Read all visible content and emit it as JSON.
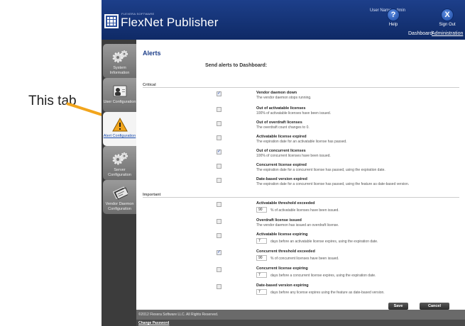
{
  "annotation": {
    "label": "This tab"
  },
  "header": {
    "vendor": "FLEXERA SOFTWARE",
    "product": "FlexNet Publisher",
    "user_name": "User Name: admin",
    "help_label": "Help",
    "help_glyph": "?",
    "signout_label": "Sign Out",
    "signout_glyph": "X",
    "links": {
      "dashboard": "Dashboard",
      "administration": "Administration"
    }
  },
  "sidebar": {
    "items": [
      {
        "label": "System Information",
        "icon": "gears-icon"
      },
      {
        "label": "User Configuration",
        "icon": "user-id-icon"
      },
      {
        "label": "Alert Configuration",
        "icon": "warning-icon",
        "active": true
      },
      {
        "label": "Server Configuration",
        "icon": "gears-icon"
      },
      {
        "label": "Vendor Daemon Configuration",
        "icon": "license-cards-icon"
      }
    ]
  },
  "main": {
    "title": "Alerts",
    "send_title": "Send alerts to Dashboard:",
    "critical_title": "Critical",
    "important_title": "Important",
    "critical": [
      {
        "title": "Vendor daemon down",
        "desc": "The vendor daemon stops running.",
        "checked": true
      },
      {
        "title": "Out of activatable licenses",
        "desc": "100% of activatable licenses have been issued.",
        "checked": false
      },
      {
        "title": "Out of overdraft licenses",
        "desc": "The overdraft count changes to 0.",
        "checked": false
      },
      {
        "title": "Activatable license expired",
        "desc": "The expiration date for an activatable license has passed.",
        "checked": false
      },
      {
        "title": "Out of concurrent licenses",
        "desc": "100% of concurrent licenses have been issued.",
        "checked": true
      },
      {
        "title": "Concurrent license expired",
        "desc": "The expiration date for a concurrent license has passed, using the expiration date.",
        "checked": false
      },
      {
        "title": "Date-based version expired",
        "desc": "The expiration date for a concurrent license has passed, using the feature as date-based version.",
        "checked": false
      }
    ],
    "important": [
      {
        "title": "Activatable threshold exceeded",
        "value": "90",
        "desc": "% of activatable licenses have been issued.",
        "checked": false
      },
      {
        "title": "Overdraft license issued",
        "desc": "The vendor daemon has issued an overdraft license.",
        "checked": false
      },
      {
        "title": "Activatable license expiring",
        "value": "7",
        "desc": "days before an activatable license expires, using the expiration date.",
        "checked": false
      },
      {
        "title": "Concurrent threshold exceeded",
        "value": "90",
        "desc": "% of concurrent licenses have been issued.",
        "checked": true
      },
      {
        "title": "Concurrent license expiring",
        "value": "7",
        "desc": "days before a concurrent license expires, using the expiration date.",
        "checked": false
      },
      {
        "title": "Date-based version expiring",
        "value": "7",
        "desc": "days before any license expires using the feature as date-based version.",
        "checked": false
      }
    ],
    "save_label": "Save",
    "cancel_label": "Cancel",
    "check_glyph": "✓"
  },
  "footer": {
    "copyright": "©2012 Flexera Software LLC. All Rights Reserved.",
    "change_password": "Change Password"
  },
  "colors": {
    "header": "#1d3f8a",
    "arrow": "#f2a51c",
    "sidebar": "#3c3c3c",
    "title": "#1d3f8a"
  }
}
